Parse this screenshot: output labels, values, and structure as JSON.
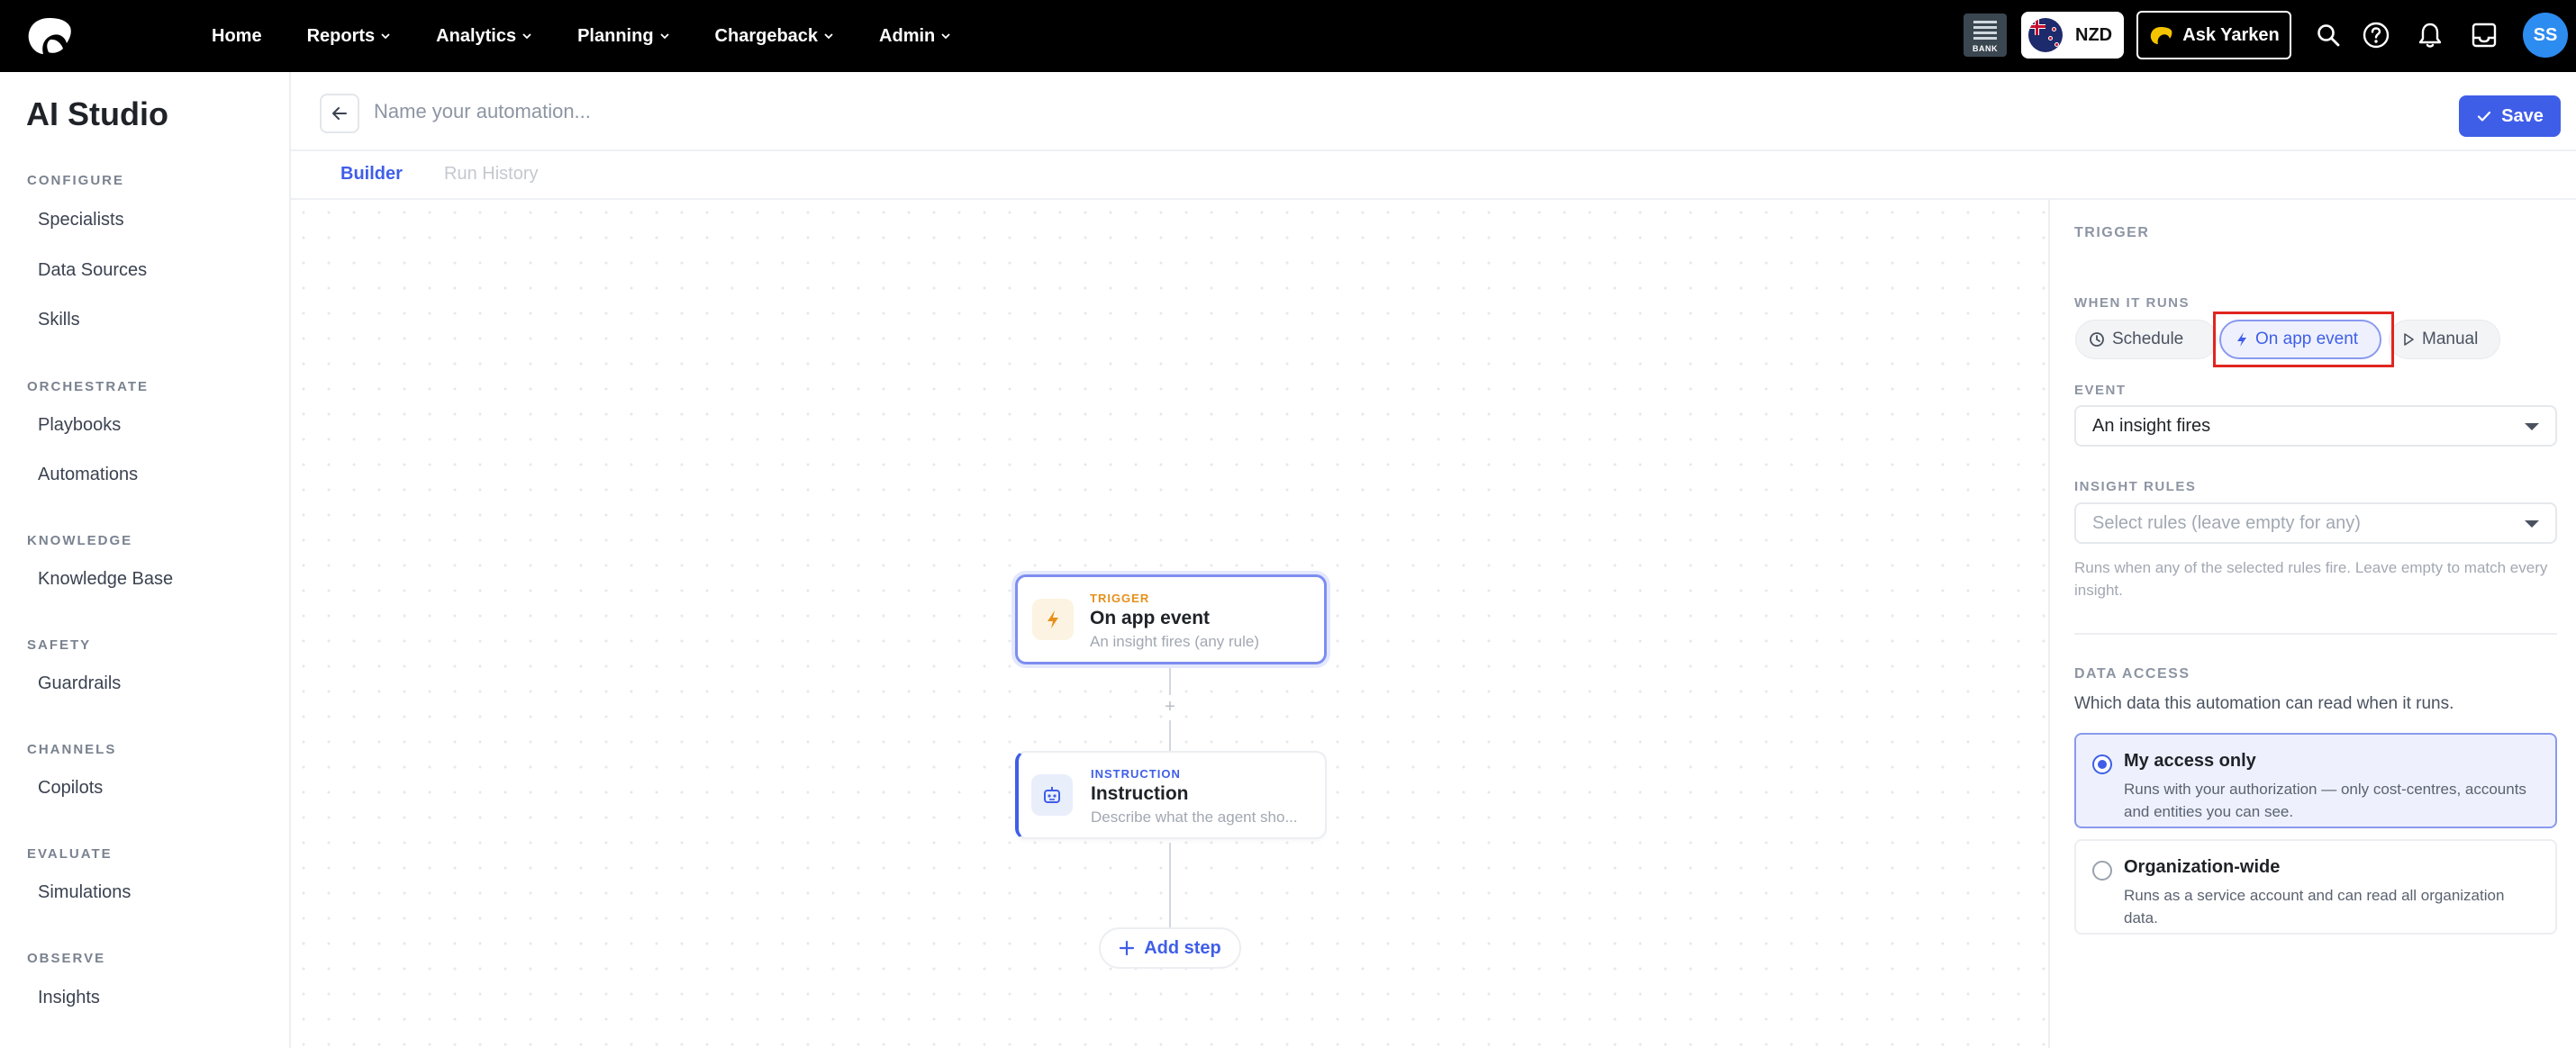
{
  "topbar": {
    "nav": [
      {
        "label": "Home",
        "has_dropdown": false
      },
      {
        "label": "Reports",
        "has_dropdown": true
      },
      {
        "label": "Analytics",
        "has_dropdown": true
      },
      {
        "label": "Planning",
        "has_dropdown": true
      },
      {
        "label": "Chargeback",
        "has_dropdown": true
      },
      {
        "label": "Admin",
        "has_dropdown": true
      }
    ],
    "bank_label": "BANK",
    "currency": "NZD",
    "ask_label": "Ask Yarken",
    "icons": [
      "search-icon",
      "help-icon",
      "bell-icon",
      "inbox-icon"
    ],
    "avatar_initials": "SS",
    "colors": {
      "bar": "#000000",
      "avatar": "#2d8cf0"
    }
  },
  "sidebar": {
    "title": "AI Studio",
    "sections": [
      {
        "title": "CONFIGURE",
        "items": [
          "Specialists",
          "Data Sources",
          "Skills"
        ]
      },
      {
        "title": "ORCHESTRATE",
        "items": [
          "Playbooks",
          "Automations"
        ]
      },
      {
        "title": "KNOWLEDGE",
        "items": [
          "Knowledge Base"
        ]
      },
      {
        "title": "SAFETY",
        "items": [
          "Guardrails"
        ]
      },
      {
        "title": "CHANNELS",
        "items": [
          "Copilots"
        ]
      },
      {
        "title": "EVALUATE",
        "items": [
          "Simulations"
        ]
      },
      {
        "title": "OBSERVE",
        "items": [
          "Insights"
        ]
      }
    ]
  },
  "header": {
    "name_placeholder": "Name your automation...",
    "name_value": "",
    "save_label": "Save",
    "tabs": [
      {
        "label": "Builder",
        "active": true
      },
      {
        "label": "Run History",
        "active": false
      }
    ]
  },
  "canvas": {
    "trigger_node": {
      "kind": "TRIGGER",
      "title": "On app event",
      "subtitle": "An insight fires (any rule)"
    },
    "instruction_node": {
      "kind": "INSTRUCTION",
      "title": "Instruction",
      "subtitle": "Describe what the agent sho..."
    },
    "add_step_label": "Add step"
  },
  "panel": {
    "section_title": "TRIGGER",
    "when_label": "WHEN IT RUNS",
    "modes": [
      {
        "label": "Schedule",
        "icon": "clock-icon",
        "selected": false
      },
      {
        "label": "On app event",
        "icon": "bolt-icon",
        "selected": true
      },
      {
        "label": "Manual",
        "icon": "play-icon",
        "selected": false
      }
    ],
    "event_label": "EVENT",
    "event_value": "An insight fires",
    "rules_label": "INSIGHT RULES",
    "rules_placeholder": "Select rules (leave empty for any)",
    "rules_helper": "Runs when any of the selected rules fire. Leave empty to match every insight.",
    "access_label": "DATA ACCESS",
    "access_desc": "Which data this automation can read when it runs.",
    "access_options": [
      {
        "title": "My access only",
        "desc": "Runs with your authorization — only cost-centres, accounts and entities you can see.",
        "selected": true
      },
      {
        "title": "Organization-wide",
        "desc": "Runs as a service account and can read all organization data.",
        "selected": false
      }
    ],
    "colors": {
      "accent": "#3f5ee8",
      "highlight": "#e0261f",
      "trigger_accent": "#e6901a"
    }
  }
}
